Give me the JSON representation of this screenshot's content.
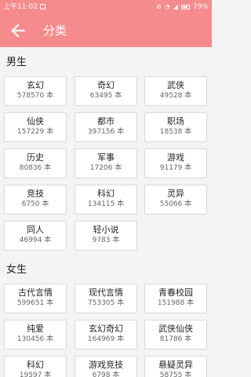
{
  "status": {
    "time": "上午11:02",
    "battery": "79%"
  },
  "header": {
    "title": "分类"
  },
  "colors": {
    "accent": "#f58b8d"
  },
  "male": {
    "title": "男生",
    "items": [
      {
        "name": "玄幻",
        "count": "578570 本"
      },
      {
        "name": "奇幻",
        "count": "63495 本"
      },
      {
        "name": "武侠",
        "count": "49528 本"
      },
      {
        "name": "仙侠",
        "count": "157229 本"
      },
      {
        "name": "都市",
        "count": "397156 本"
      },
      {
        "name": "职场",
        "count": "18538 本"
      },
      {
        "name": "历史",
        "count": "80836 本"
      },
      {
        "name": "军事",
        "count": "17206 本"
      },
      {
        "name": "游戏",
        "count": "91179 本"
      },
      {
        "name": "竞技",
        "count": "6750 本"
      },
      {
        "name": "科幻",
        "count": "134115 本"
      },
      {
        "name": "灵异",
        "count": "55066 本"
      },
      {
        "name": "同人",
        "count": "46994 本"
      },
      {
        "name": "轻小说",
        "count": "9783 本"
      }
    ]
  },
  "female": {
    "title": "女生",
    "items": [
      {
        "name": "古代言情",
        "count": "599651 本"
      },
      {
        "name": "现代言情",
        "count": "753305 本"
      },
      {
        "name": "青春校园",
        "count": "151988 本"
      },
      {
        "name": "纯爱",
        "count": "130456 本"
      },
      {
        "name": "玄幻奇幻",
        "count": "164969 本"
      },
      {
        "name": "武侠仙侠",
        "count": "81786 本"
      },
      {
        "name": "科幻",
        "count": "19597 本"
      },
      {
        "name": "游戏竞技",
        "count": "6798 本"
      },
      {
        "name": "悬疑灵异",
        "count": "58755 本"
      }
    ]
  }
}
